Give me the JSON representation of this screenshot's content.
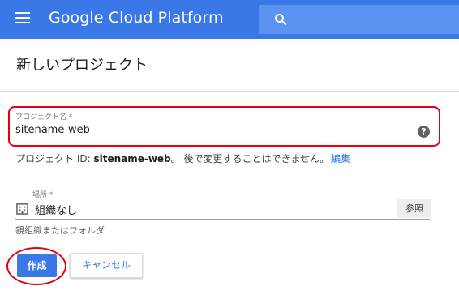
{
  "header": {
    "menu_icon": "hamburger-menu-icon",
    "brand": "Google Cloud Platform",
    "search_icon": "search-icon",
    "color": "#3b78e7"
  },
  "page": {
    "title": "新しいプロジェクト"
  },
  "project_name": {
    "label": "プロジェクト名 *",
    "value": "sitename-web",
    "help_icon": "help-icon",
    "help_glyph": "?"
  },
  "project_id": {
    "prefix": "プロジェクト ID: ",
    "id": "sitename-web",
    "suffix": "。 後で変更することはできません。",
    "edit_label": "編集"
  },
  "location": {
    "label": "場所 *",
    "icon": "building-icon",
    "value": "組織なし",
    "browse_label": "参照",
    "hint": "親組織またはフォルダ"
  },
  "actions": {
    "create_label": "作成",
    "cancel_label": "キャンセル"
  },
  "annotations": {
    "color": "#e3000f"
  }
}
